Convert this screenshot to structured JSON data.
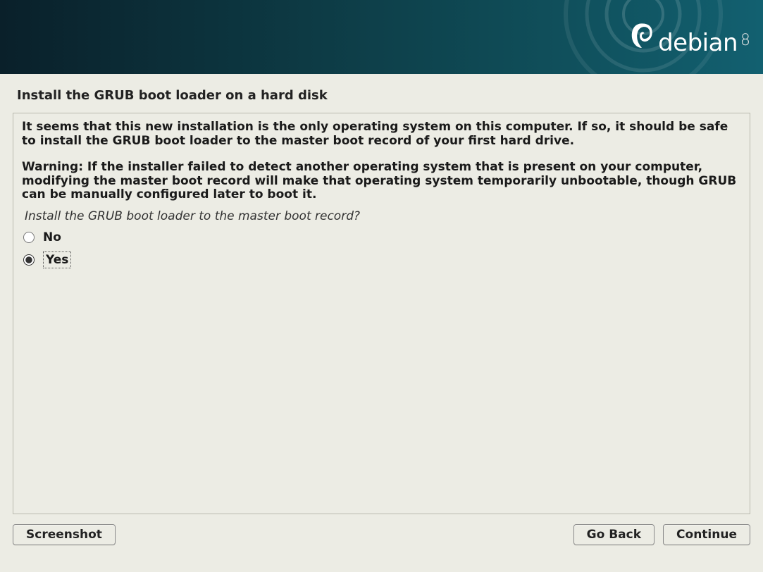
{
  "header": {
    "logo_text": "debian",
    "logo_version": "8"
  },
  "page": {
    "title": "Install the GRUB boot loader on a hard disk",
    "info": "It seems that this new installation is the only operating system on this computer. If so, it should be safe to install the GRUB boot loader to the master boot record of your first hard drive.",
    "warning": "Warning: If the installer failed to detect another operating system that is present on your computer, modifying the master boot record will make that operating system temporarily unbootable, though GRUB can be manually configured later to boot it.",
    "question": "Install the GRUB boot loader to the master boot record?",
    "options": {
      "no": "No",
      "yes": "Yes"
    },
    "selected": "yes"
  },
  "buttons": {
    "screenshot": "Screenshot",
    "go_back": "Go Back",
    "continue": "Continue"
  }
}
